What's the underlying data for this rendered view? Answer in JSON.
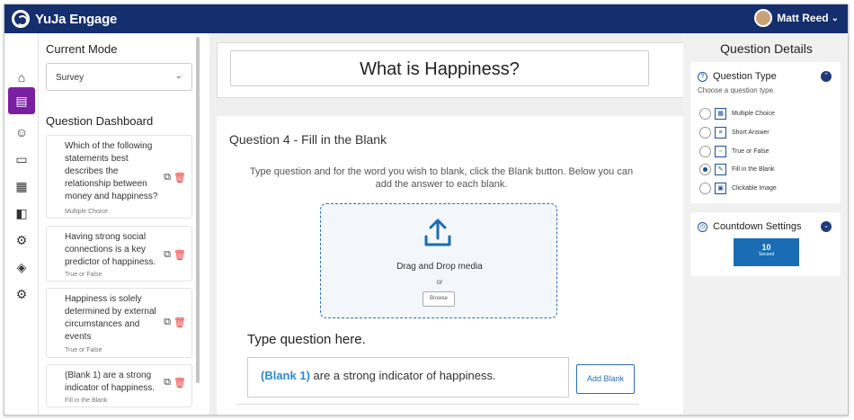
{
  "app": {
    "brand": "YuJa Engage",
    "user_name": "Matt Reed"
  },
  "left_panel": {
    "mode_heading": "Current Mode",
    "mode_value": "Survey",
    "dashboard_heading": "Question Dashboard",
    "questions": [
      {
        "text": "Which of the following statements best describes the relationship between money and happiness?",
        "type": "Multiple Choice"
      },
      {
        "text": "Having strong social connections is a key predictor of happiness.",
        "type": "True or False"
      },
      {
        "text": "Happiness is solely determined by external circumstances and events",
        "type": "True or False"
      },
      {
        "text": "(Blank 1) are a strong indicator of happiness.",
        "type": "Fill in the Blank"
      }
    ]
  },
  "main": {
    "title": "What is Happiness?",
    "question_heading": "Question 4 - Fill in the Blank",
    "instructions": "Type question and for the word you wish to blank, click the Blank button. Below you can add the answer to each blank.",
    "drop_text": "Drag and Drop media",
    "or_text": "or",
    "browse_label": "Browse",
    "type_question_label": "Type question here.",
    "answer_blank": "(Blank 1)",
    "answer_rest": " are a strong indicator of happiness.",
    "add_blank_label": "Add Blank"
  },
  "right_panel": {
    "title": "Question Details",
    "type_heading": "Question Type",
    "type_sub": "Choose a question type.",
    "type_options": [
      {
        "label": "Multiple Choice",
        "selected": false
      },
      {
        "label": "Short Answer",
        "selected": false
      },
      {
        "label": "True or False",
        "selected": false
      },
      {
        "label": "Fill in the Blank",
        "selected": true
      },
      {
        "label": "Clickable Image",
        "selected": false
      }
    ],
    "countdown_heading": "Countdown Settings",
    "countdown_value": "10",
    "countdown_unit": "Second"
  },
  "colors": {
    "topbar": "#142e6e",
    "accent": "#1a6db5",
    "active_rail": "#7b1fa2",
    "trash": "#e53935"
  }
}
